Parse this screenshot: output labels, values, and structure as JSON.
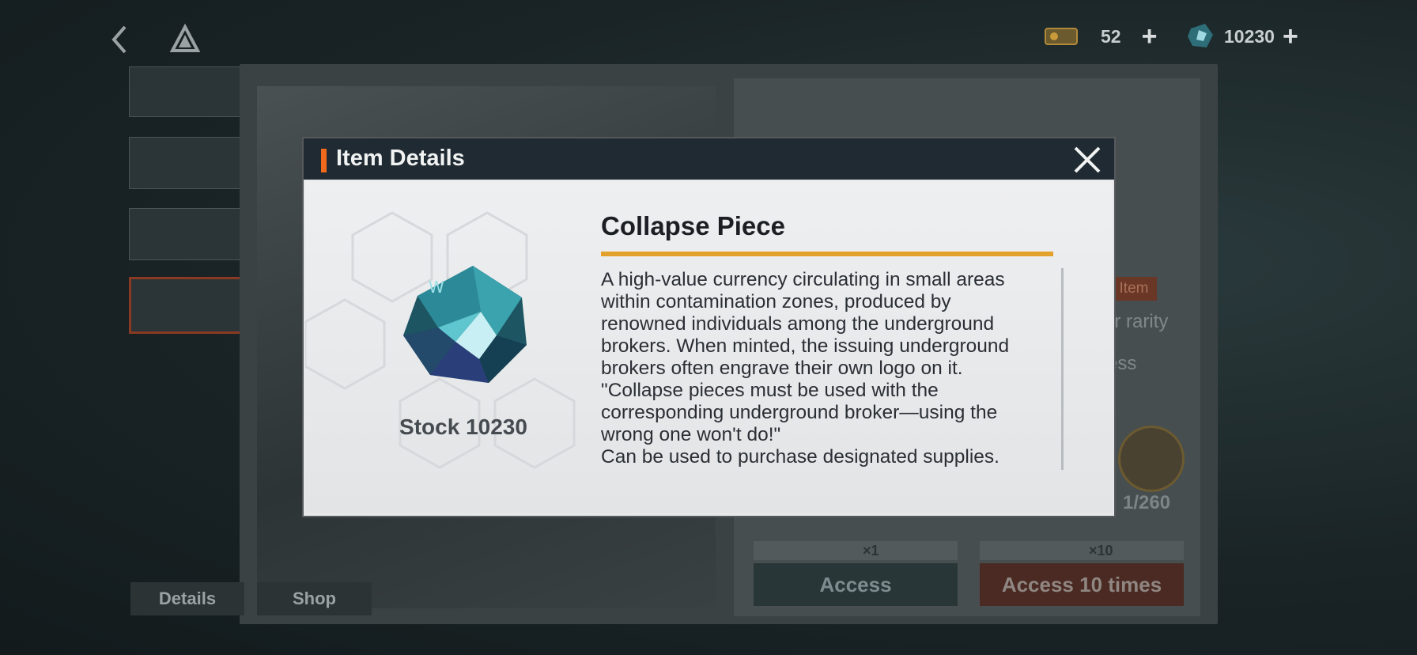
{
  "topbar": {
    "currency_tickets": {
      "value": "52",
      "icon": "ticket-icon"
    },
    "currency_pieces": {
      "value": "10230",
      "icon": "collapse-piece-icon"
    }
  },
  "shop": {
    "tabs": [
      {
        "label": "Details"
      },
      {
        "label": "Shop"
      }
    ],
    "access": {
      "label": "Access",
      "cost": "×1"
    },
    "access10": {
      "label": "Access 10 times",
      "cost": "×10"
    },
    "side_tag": "Item",
    "side_lines": [
      "er rarity",
      "ess"
    ],
    "collection_count": "1/260"
  },
  "modal": {
    "title": "Item Details",
    "item": {
      "name": "Collapse Piece",
      "stock": "Stock 10230",
      "description": "A high-value currency circulating in small areas\nwithin contamination zones, produced by\nrenowned individuals among the underground\nbrokers. When minted, the issuing underground\nbrokers often engrave their own logo on it.\n\"Collapse pieces must be used with the\ncorresponding underground broker—using the\nwrong one won't do!\"\nCan be used to purchase designated supplies."
    }
  },
  "colors": {
    "accent_orange": "#f06a1e",
    "underline_gold": "#e2a12a",
    "header_dark": "#1f2a32"
  }
}
